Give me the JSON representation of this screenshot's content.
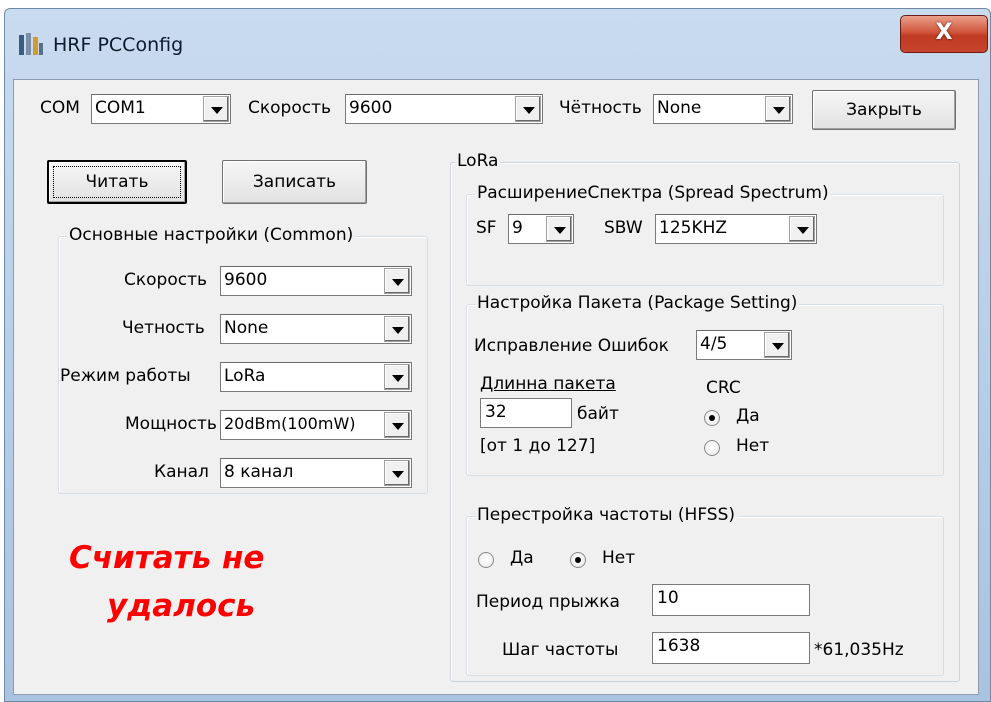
{
  "window": {
    "title": "HRF PCConfig",
    "close_glyph": "X",
    "app_icon": "bars-icon"
  },
  "top": {
    "com_label": "COM",
    "com_value": "COM1",
    "speed_label": "Скорость",
    "speed_value": "9600",
    "parity_label": "Чётность",
    "parity_value": "None",
    "close_button": "Закрыть"
  },
  "actions": {
    "read_button": "Читать",
    "write_button": "Записать"
  },
  "common": {
    "title": "Основные настройки (Common)",
    "speed_label": "Скорость",
    "speed_value": "9600",
    "parity_label": "Четность",
    "parity_value": "None",
    "mode_label": "Режим работы",
    "mode_value": "LoRa",
    "power_label": "Мощность",
    "power_value": "20dBm(100mW)",
    "channel_label": "Канал",
    "channel_value": "8 канал"
  },
  "status": {
    "line1": "Считать не",
    "line2": "удалось",
    "color": "#ff0000"
  },
  "lora": {
    "title": "LoRa",
    "spread": {
      "title": "РасширениеСпектра (Spread Spectrum)",
      "sf_label": "SF",
      "sf_value": "9",
      "sbw_label": "SBW",
      "sbw_value": "125KHZ"
    },
    "package": {
      "title": "Настройка Пакета (Package Setting)",
      "fec_label": "Исправление Ошибок",
      "fec_value": "4/5",
      "length_label": "Длинна пакета",
      "length_value": "32",
      "length_unit": "байт",
      "length_range": "[от 1 до 127]",
      "crc_label": "CRC",
      "crc_yes": "Да",
      "crc_no": "Нет",
      "crc_selected": "yes"
    },
    "hfss": {
      "title": "Перестройка частоты (HFSS)",
      "yes": "Да",
      "no": "Нет",
      "selected": "no",
      "hop_label": "Период прыжка",
      "hop_value": "10",
      "step_label": "Шаг частоты",
      "step_value": "1638",
      "step_unit": "*61,035Hz"
    }
  }
}
